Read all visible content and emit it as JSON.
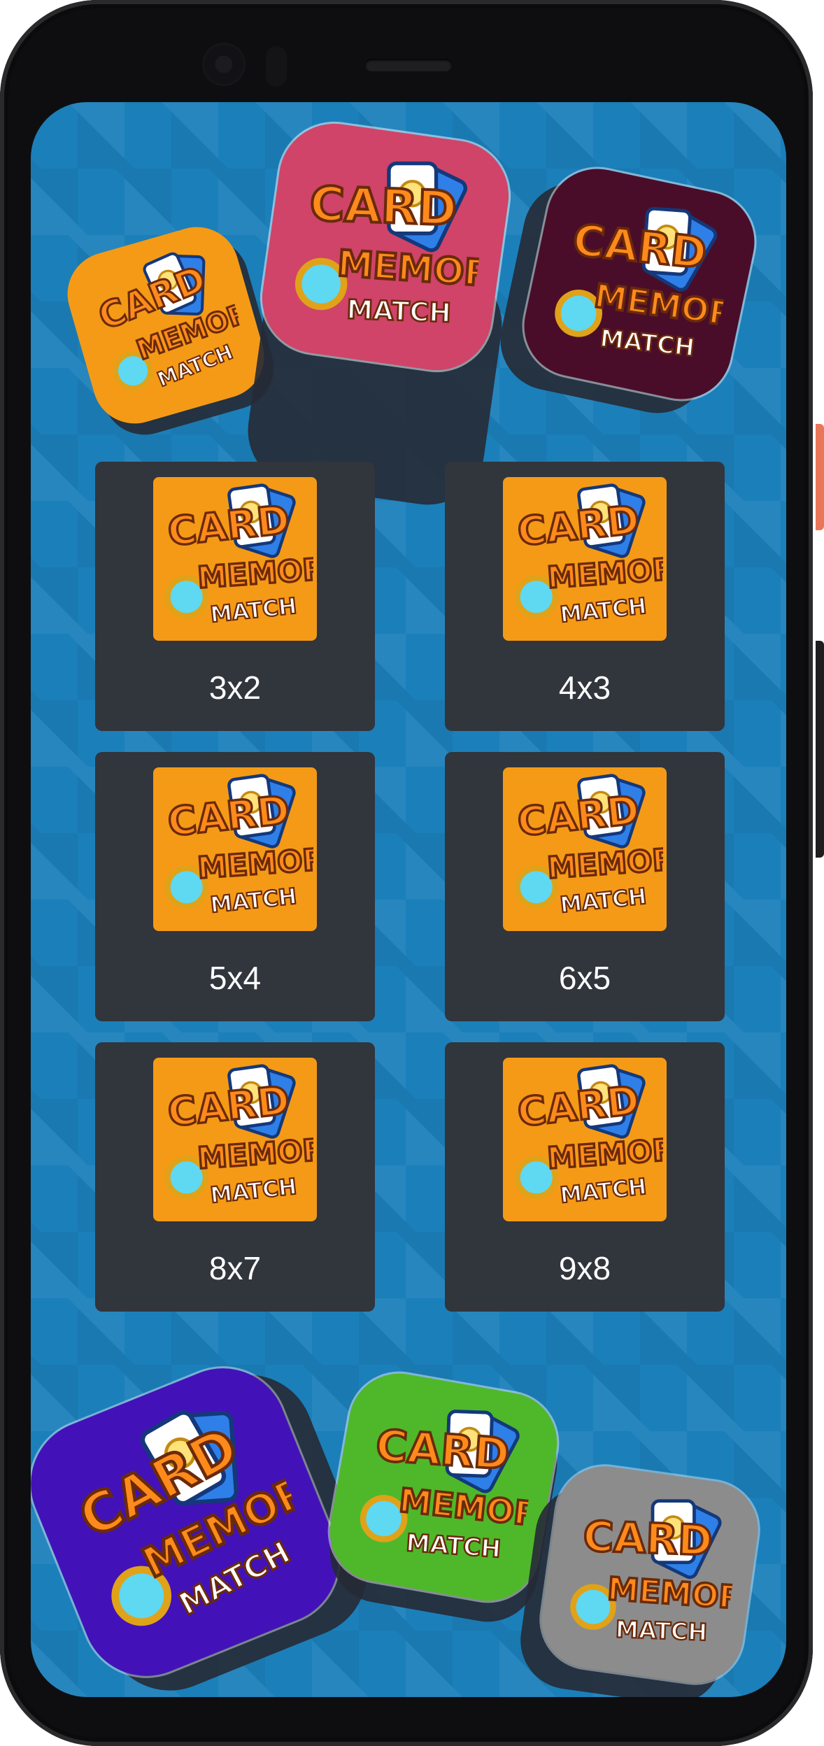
{
  "app": {
    "logo_text": [
      "CARD",
      "MEMORY",
      "MATCH"
    ]
  },
  "theme": {
    "background": "#1b7fba",
    "card_background": "#31353c",
    "thumb_background": "#f59a16",
    "label_color": "#ffffff",
    "logo_orange": "#ff8a1c",
    "logo_outline": "#6a2a0a",
    "logo_card_blue": "#2f7fe8",
    "logo_lens": "#5fd8f2"
  },
  "decor_top": [
    {
      "name": "logo-tile-orange",
      "color": "#f59a16",
      "icon": "card-memory-match-logo"
    },
    {
      "name": "logo-tile-pink",
      "color": "#cf4468",
      "icon": "card-memory-match-logo"
    },
    {
      "name": "logo-tile-maroon",
      "color": "#4a0d29",
      "icon": "card-memory-match-logo"
    }
  ],
  "decor_bottom": [
    {
      "name": "logo-tile-purple",
      "color": "#4212b8",
      "icon": "card-memory-match-logo"
    },
    {
      "name": "logo-tile-green",
      "color": "#4eb82a",
      "icon": "card-memory-match-logo"
    },
    {
      "name": "logo-tile-gray",
      "color": "#8c8c8c",
      "icon": "card-memory-match-logo"
    }
  ],
  "levels": [
    {
      "label": "3x2"
    },
    {
      "label": "4x3"
    },
    {
      "label": "5x4"
    },
    {
      "label": "6x5"
    },
    {
      "label": "8x7"
    },
    {
      "label": "9x8"
    }
  ]
}
